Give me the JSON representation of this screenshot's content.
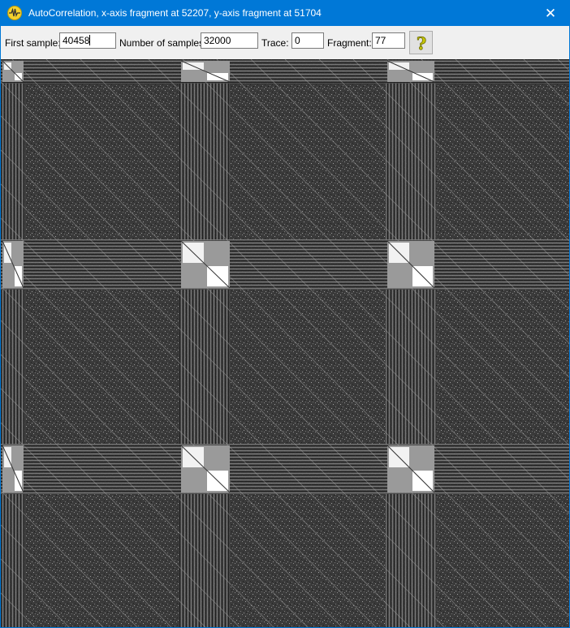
{
  "window": {
    "title": "AutoCorrelation, x-axis fragment at 52207, y-axis fragment at 51704",
    "close_symbol": "✕",
    "app_icon": "waveform-icon"
  },
  "toolbar": {
    "first_sample_label": "First sample:",
    "first_sample_value": "40458",
    "num_samples_label": "Number of samples:",
    "num_samples_value": "32000",
    "trace_label": "Trace:",
    "trace_value": "0",
    "fragment_label": "Fragment:",
    "fragment_value": "77",
    "help_icon": "question-mark-icon",
    "help_symbol": "?"
  },
  "plot": {
    "type": "autocorrelation-dot-plot",
    "colors": {
      "background": "#3a3a3a",
      "bright": "#ffffff",
      "band": "#5a5a5a"
    }
  }
}
